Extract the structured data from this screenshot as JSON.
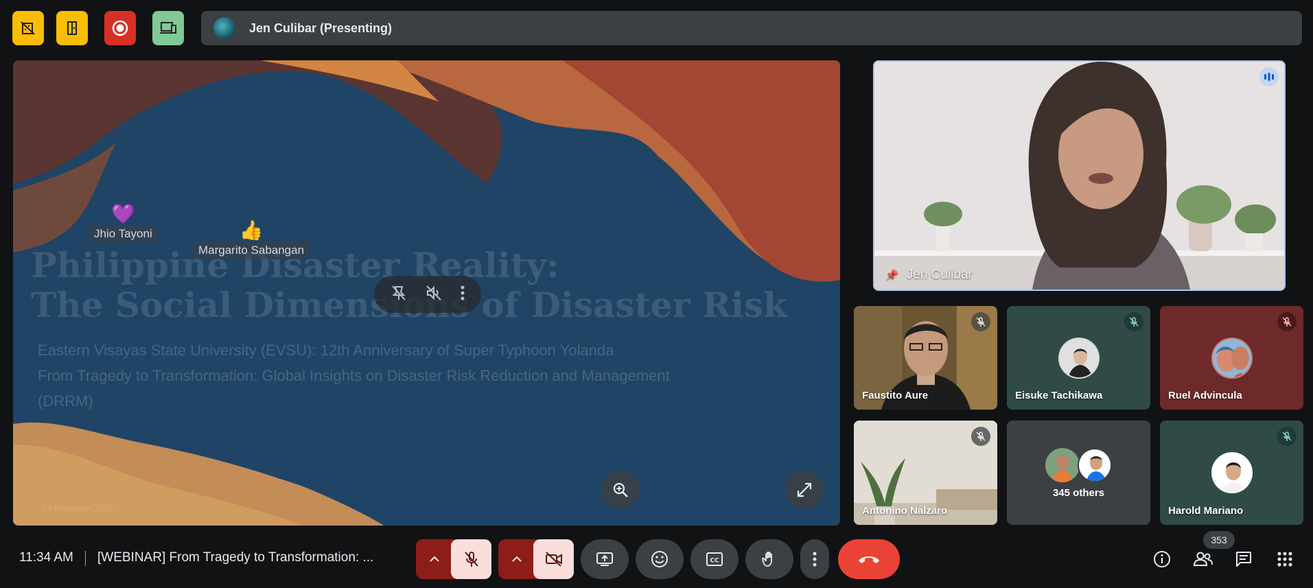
{
  "top_bar": {
    "icons": [
      {
        "name": "crossed-building-icon",
        "color": "#fbbc04"
      },
      {
        "name": "door-icon",
        "color": "#fbbc04"
      },
      {
        "name": "record-icon",
        "color": "#d93025"
      },
      {
        "name": "devices-icon",
        "color": "#81c995"
      }
    ],
    "presenting_label": "Jen Culibar (Presenting)"
  },
  "slide": {
    "title_line1": "Philippine Disaster Reality:",
    "title_line2": "The Social Dimensions of Disaster Risk",
    "subtitle_line1": "Eastern Visayas State University (EVSU): 12th Anniversary of Super Typhoon Yolanda",
    "subtitle_line2": "From Tragedy to Transformation: Global Insights on Disaster Risk Reduction and Management",
    "subtitle_line3": "(DRRM)",
    "footer_left": "1/8 November 2025",
    "reactions": [
      {
        "name": "Jhio Tayoni",
        "emoji": "💜"
      },
      {
        "name": "Margarito Sabangan",
        "emoji": "👍"
      }
    ]
  },
  "main_speaker": {
    "name": "Jen Culibar"
  },
  "participants": [
    {
      "name": "Faustito Aure",
      "muted": true
    },
    {
      "name": "Eisuke Tachikawa",
      "muted": true
    },
    {
      "name": "Ruel Advincula",
      "muted": true
    },
    {
      "name": "Antonino Nalzaro",
      "muted": true
    },
    {
      "name": "345 others",
      "muted": false
    },
    {
      "name": "Harold Mariano",
      "muted": true
    }
  ],
  "bottom_bar": {
    "time": "11:34 AM",
    "meeting_title": "[WEBINAR] From Tragedy to Transformation: ...",
    "participant_count": "353"
  },
  "colors": {
    "end_call": "#ea4335",
    "muted_bg": "#f9dedc",
    "muted_dark": "#8c1d18",
    "accent_border": "#a8c7fa"
  }
}
